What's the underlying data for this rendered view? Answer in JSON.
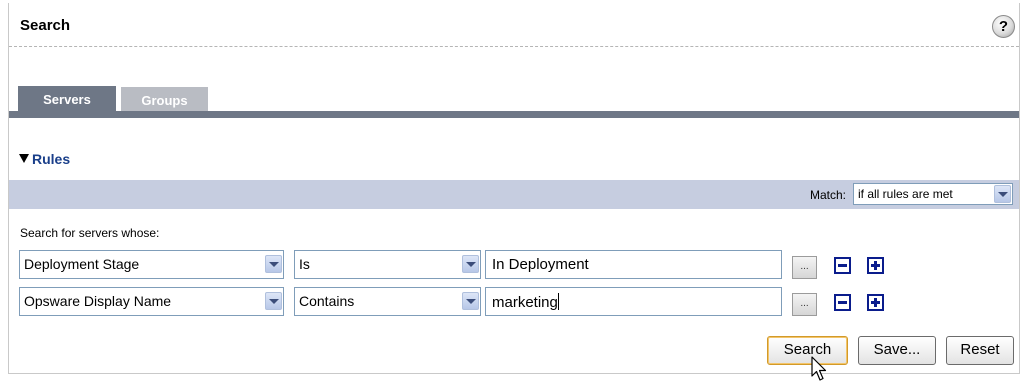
{
  "header": {
    "title": "Search",
    "help_symbol": "?"
  },
  "tabs": [
    {
      "label": "Servers",
      "active": true
    },
    {
      "label": "Groups",
      "active": false
    }
  ],
  "rules": {
    "label": "Rules",
    "expanded": true
  },
  "match": {
    "label": "Match:",
    "selected": "if all rules are met"
  },
  "search_label": "Search for servers whose:",
  "rows": [
    {
      "attribute": "Deployment Stage",
      "operator": "Is",
      "value": "In Deployment",
      "browse_label": "..."
    },
    {
      "attribute": "Opsware Display Name",
      "operator": "Contains",
      "value": "marketing",
      "browse_label": "..."
    }
  ],
  "buttons": {
    "search": "Search",
    "save": "Save...",
    "reset": "Reset"
  },
  "colors": {
    "tab_active": "#6e7786",
    "tab_inactive": "#b9bcc3",
    "match_bar": "#c6cde0",
    "rules_link": "#1a3f8a",
    "plus_minus": "#0a1c8c"
  },
  "icons": {
    "help": "help-icon",
    "expand": "triangle-down-icon",
    "remove_rule": "minus-box-icon",
    "add_rule": "plus-box-icon",
    "pointer": "mouse-pointer-icon"
  }
}
